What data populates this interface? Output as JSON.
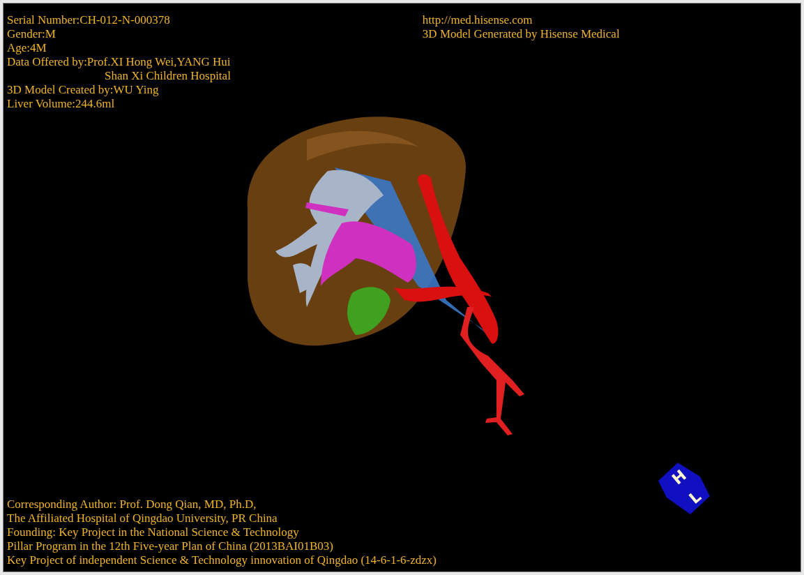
{
  "info_lines": [
    {
      "text": "Serial Number:CH-012-N-000378",
      "continuation": false
    },
    {
      "text": "Gender:M",
      "continuation": false
    },
    {
      "text": "Age:4M",
      "continuation": false
    },
    {
      "text": "Data Offered by:Prof.XI Hong Wei,YANG Hui",
      "continuation": false
    },
    {
      "text": "Shan Xi Children Hospital",
      "continuation": true
    },
    {
      "text": "3D Model Created by:WU Ying",
      "continuation": false
    },
    {
      "text": "Liver Volume:244.6ml",
      "continuation": false
    }
  ],
  "brand_lines": [
    "http://med.hisense.com",
    "3D Model Generated by Hisense Medical"
  ],
  "credit_lines": [
    "Corresponding Author: Prof. Dong Qian, MD, Ph.D,",
    "The Affiliated Hospital of Qingdao University, PR China",
    "Founding: Key Project in the National Science & Technology",
    "Pillar Program in the 12th Five-year Plan of China (2013BAI01B03)",
    "Key Project of independent Science & Technology innovation of Qingdao (14-6-1-6-zdzx)"
  ],
  "orientation_cube": {
    "labels": [
      "H",
      "L"
    ]
  }
}
